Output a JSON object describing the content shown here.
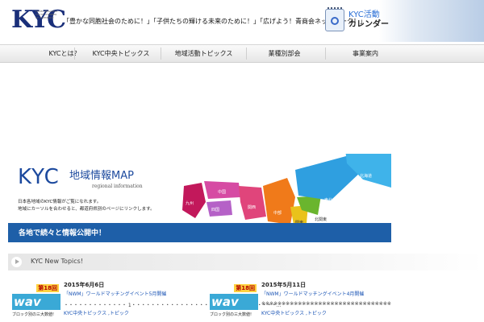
{
  "header": {
    "logo_text": "KYC",
    "logo_small": "CHŪBU REGIONAL YOUTH CHAMBER OF COMMERCE",
    "tagline": "「豊かな同胞社会のために！」「子供たちの輝ける未来のために！」「広げよう！青商会ネットワーク！」",
    "calendar_line1": "KYC活動",
    "calendar_line2": "カレンダー"
  },
  "nav": {
    "items": [
      {
        "label": "KYCとは？"
      },
      {
        "label": "KYC中央トピックス"
      },
      {
        "label": "地域活動トピックス"
      },
      {
        "label": "業種別部会"
      },
      {
        "label": "事業案内"
      }
    ]
  },
  "map_banner": {
    "kyc": "KYC",
    "title": "地域情報MAP",
    "subtitle": "regional information",
    "desc1": "日本各地域のKYC情報がご覧になれます。",
    "desc2": "地域にカーソルを合わせると、都道府県別のページにリンクします。",
    "bar_text": "各地で続々と情報公開中！",
    "regions": {
      "kyushu": "九州",
      "chugoku": "中国",
      "shikoku": "四国",
      "kansai": "関西",
      "chubu": "中部",
      "kanto": "関東",
      "kitakanto": "北関東",
      "tohoku": "東北",
      "hokkaido": "北海道"
    },
    "colors": {
      "kyushu": "#c2185b",
      "chugoku": "#d64ba3",
      "shikoku": "#b561c7",
      "kansai": "#e0457b",
      "chubu": "#f07a1a",
      "kanto": "#e9c21b",
      "kitakanto": "#6ab52e",
      "tohoku": "#2f9fe0",
      "hokkaido": "#3fb3ea"
    }
  },
  "topics": {
    "header": "KYC New Topics!",
    "items": [
      {
        "badge": "第18回",
        "wave": "wav",
        "caption": "ブロック別の三大数値!",
        "date": "2015年6月6日",
        "title": "「NWM」ワールドマッチングイベント5月開催",
        "body": "・・・・・・・・・・・・・ 1・・・・・・・・・・・・・・・・・・・・・・・・・・・・・・...",
        "category": "KYC中央トピックス ,トピック"
      },
      {
        "badge": "第18回",
        "wave": "wav",
        "caption": "ブロック別の三大数値!",
        "date": "2015年5月11日",
        "title": "「NWM」ワールドマッチングイベント4月開催",
        "body": "※※※※※※※※※※※※※※※※※※※※※※※※※※※※※※※※",
        "category": "KYC中央トピックス ,トピック"
      }
    ]
  }
}
